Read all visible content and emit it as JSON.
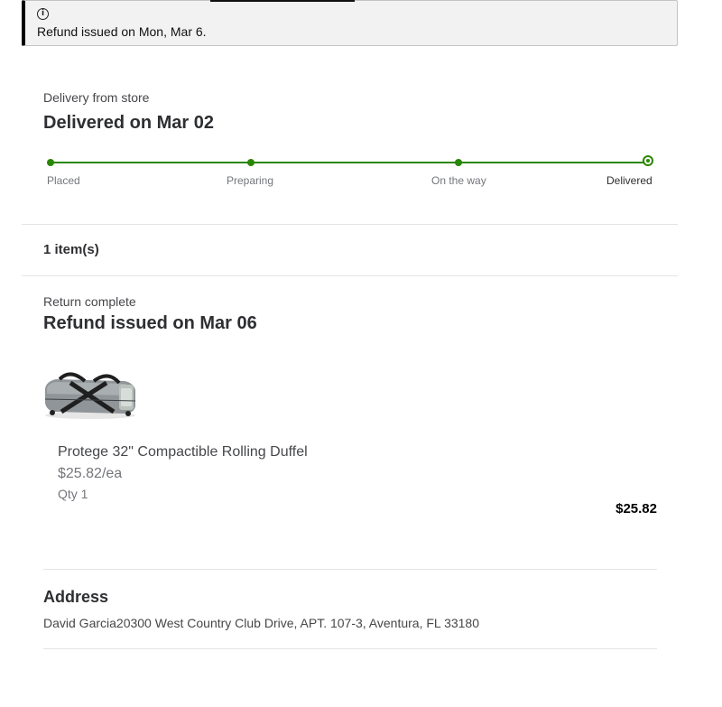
{
  "alert": {
    "icon": "info-icon",
    "icon_glyph": "i",
    "message": "Refund issued on Mon, Mar 6."
  },
  "delivery": {
    "subtitle": "Delivery from store",
    "title": "Delivered on Mar 02",
    "steps": [
      "Placed",
      "Preparing",
      "On the way",
      "Delivered"
    ],
    "accent_color": "#2a8703"
  },
  "items": {
    "count_label": "1 item(s)"
  },
  "return": {
    "status": "Return complete",
    "title": "Refund issued on Mar 06"
  },
  "product": {
    "name": "Protege 32\" Compactible Rolling Duffel",
    "unit_price": "$25.82/ea",
    "qty": "Qty 1",
    "total": "$25.82"
  },
  "address": {
    "title": "Address",
    "text": "David Garcia20300 West Country Club Drive, APT. 107-3, Aventura, FL 33180"
  }
}
